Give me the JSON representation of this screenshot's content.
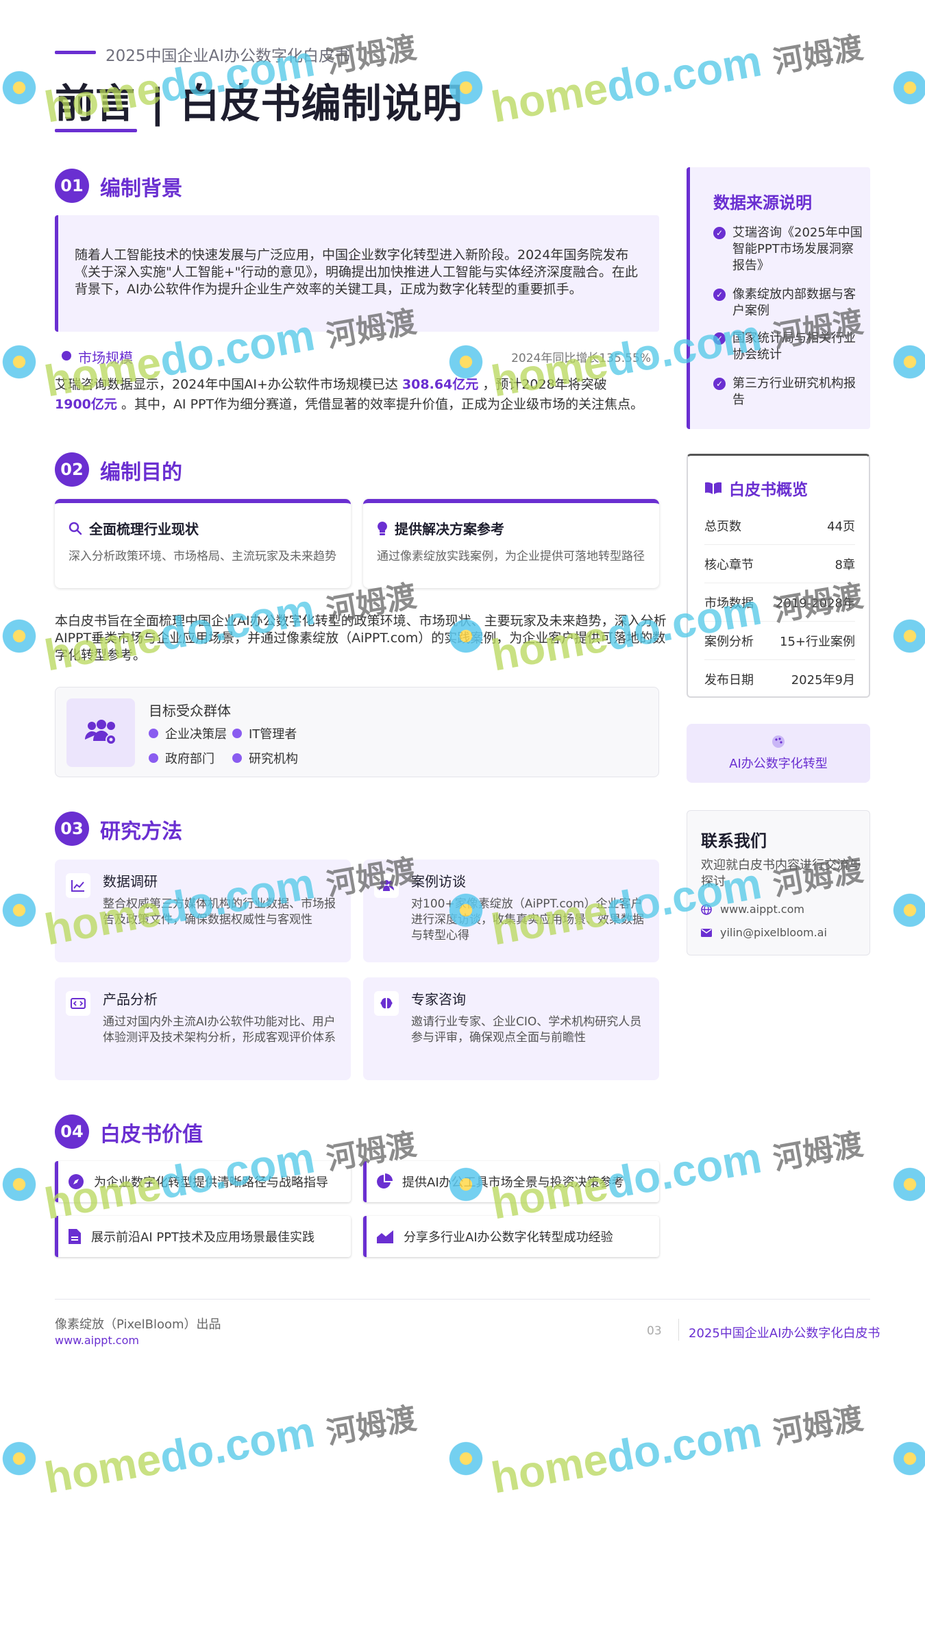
{
  "header": {
    "subtitle": "2025中国企业AI办公数字化白皮书",
    "title": "前言 | 白皮书编制说明"
  },
  "sections": [
    {
      "num": "01",
      "title": "编制背景"
    },
    {
      "num": "02",
      "title": "编制目的"
    },
    {
      "num": "03",
      "title": "研究方法"
    },
    {
      "num": "04",
      "title": "白皮书价值"
    }
  ],
  "background": {
    "paragraph": "随着人工智能技术的快速发展与广泛应用，中国企业数字化转型进入新阶段。2024年国务院发布《关于深入实施\"人工智能+\"行动的意见》，明确提出加快推进人工智能与实体经济深度融合。在此背景下，AI办公软件作为提升企业生产效率的关键工具，正成为数字化转型的重要抓手。",
    "market_label": "市场规模",
    "market_growth": "2024年同比增长135.55%",
    "market_text_1": "艾瑞咨询数据显示，2024年中国AI+办公软件市场规模已达",
    "market_value_1": "308.64亿元",
    "market_text_2": "，预计2028年将突破",
    "market_value_2": "1900亿元",
    "market_text_3": "。其中，AI PPT作为细分赛道，凭借显著的效率提升价值，正成为企业级市场的关注焦点。"
  },
  "purpose": {
    "cards": [
      {
        "title": "全面梳理行业现状",
        "desc": "深入分析政策环境、市场格局、主流玩家及未来趋势"
      },
      {
        "title": "提供解决方案参考",
        "desc": "通过像素绽放实践案例，为企业提供可落地转型路径"
      }
    ],
    "text": "本白皮书旨在全面梳理中国企业AI办公数字化转型的政策环境、市场现状、主要玩家及未来趋势，深入分析AIPPT垂类市场与企业应用场景，并通过像素绽放（AiPPT.com）的实践案例，为企业客户提供可落地的数字化转型参考。",
    "audience_title": "目标受众群体",
    "audience": [
      "企业决策层",
      "IT管理者",
      "政府部门",
      "研究机构"
    ]
  },
  "methods": [
    {
      "icon": "chart-line-icon",
      "title": "数据调研",
      "desc": "整合权威第三方媒体机构的行业数据、市场报告及政策文件，确保数据权威性与客观性"
    },
    {
      "icon": "users-icon",
      "title": "案例访谈",
      "desc": "对100+家像素绽放（AiPPT.com）企业客户进行深度访谈，收集真实应用场景、效果数据与转型心得"
    },
    {
      "icon": "code-icon",
      "title": "产品分析",
      "desc": "通过对国内外主流AI办公软件功能对比、用户体验测评及技术架构分析，形成客观评价体系"
    },
    {
      "icon": "brain-icon",
      "title": "专家咨询",
      "desc": "邀请行业专家、企业CIO、学术机构研究人员参与评审，确保观点全面与前瞻性"
    }
  ],
  "values": [
    {
      "icon": "compass-icon",
      "text": "为企业数字化转型提供清晰路径与战略指导"
    },
    {
      "icon": "pie-chart-icon",
      "text": "提供AI办公工具市场全景与投资决策参考"
    },
    {
      "icon": "document-icon",
      "text": "展示前沿AI PPT技术及应用场景最佳实践"
    },
    {
      "icon": "area-chart-icon",
      "text": "分享多行业AI办公数字化转型成功经验"
    }
  ],
  "sources": {
    "title": "数据来源说明",
    "items": [
      "艾瑞咨询《2025年中国智能PPT市场发展洞察报告》",
      "像素绽放内部数据与客户案例",
      "国家统计局与相关行业协会统计",
      "第三方行业研究机构报告"
    ]
  },
  "overview": {
    "title": "白皮书概览",
    "rows": [
      {
        "label": "总页数",
        "value": "44页"
      },
      {
        "label": "核心章节",
        "value": "8章"
      },
      {
        "label": "市场数据",
        "value": "2019-2028年"
      },
      {
        "label": "案例分析",
        "value": "15+行业案例"
      },
      {
        "label": "发布日期",
        "value": "2025年9月"
      }
    ]
  },
  "transformation": {
    "label": "AI办公数字化转型"
  },
  "contact": {
    "title": "联系我们",
    "desc": "欢迎就白皮书内容进行交流与探讨",
    "website": "www.aippt.com",
    "email": "yilin@pixelbloom.ai"
  },
  "footer": {
    "brand": "像素绽放（PixelBloom）出品",
    "url": "www.aippt.com",
    "page": "03",
    "title": "2025中国企业AI办公数字化白皮书"
  },
  "watermark": {
    "text_green": "home",
    "text_blue": "do.com",
    "text_cn": "河姆渡"
  },
  "colors": {
    "accent": "#6a2fd1",
    "accent_light": "#f4f0fe"
  }
}
